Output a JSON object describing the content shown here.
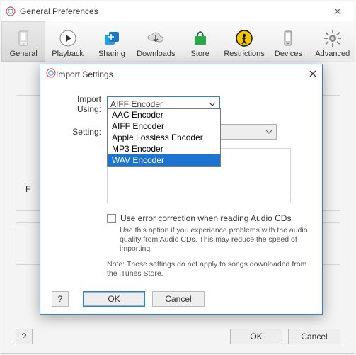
{
  "outer": {
    "title": "General Preferences",
    "tabs": [
      {
        "label": "General"
      },
      {
        "label": "Playback"
      },
      {
        "label": "Sharing"
      },
      {
        "label": "Downloads"
      },
      {
        "label": "Store"
      },
      {
        "label": "Restrictions"
      },
      {
        "label": "Devices"
      },
      {
        "label": "Advanced"
      }
    ],
    "help": "?",
    "ok": "OK",
    "cancel": "Cancel"
  },
  "modal": {
    "title": "Import Settings",
    "import_using_label": "Import Using:",
    "import_using_value": "AIFF Encoder",
    "setting_label": "Setting:",
    "dropdown": [
      "AAC Encoder",
      "AIFF Encoder",
      "Apple Lossless Encoder",
      "MP3 Encoder",
      "WAV Encoder"
    ],
    "selected_dropdown": "WAV Encoder",
    "checkbox_label": "Use error correction when reading Audio CDs",
    "helptext": "Use this option if you experience problems with the audio quality from Audio CDs.  This may reduce the speed of importing.",
    "note": "Note: These settings do not apply to songs downloaded from the iTunes Store.",
    "help": "?",
    "ok": "OK",
    "cancel": "Cancel"
  },
  "partial_labels": {
    "F": "F"
  }
}
